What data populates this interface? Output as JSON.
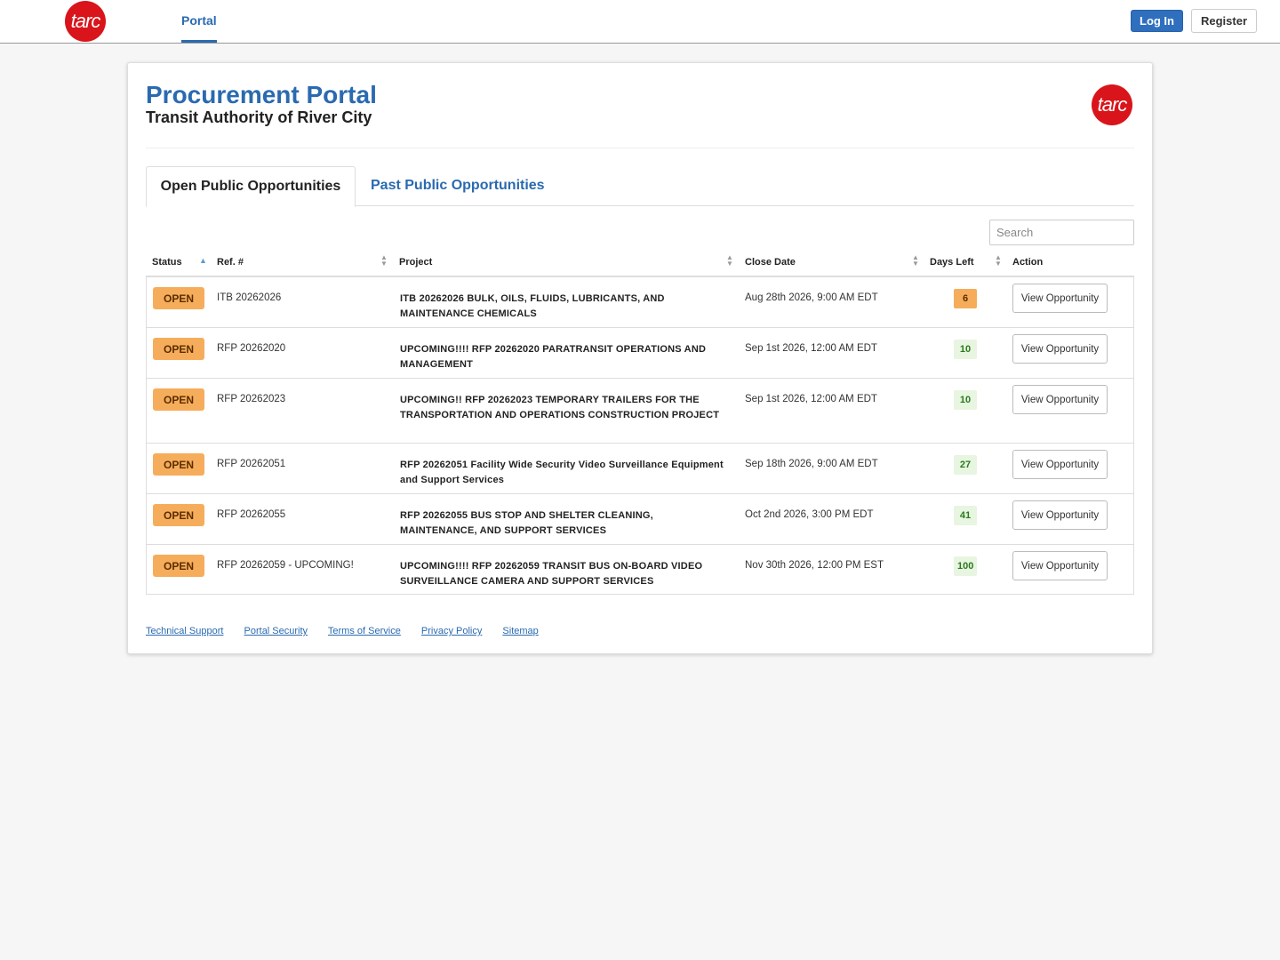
{
  "nav": {
    "logo_text": "tarc",
    "portal_label": "Portal",
    "login_label": "Log In",
    "register_label": "Register"
  },
  "header": {
    "title": "Procurement Portal",
    "subtitle": "Transit Authority of River City",
    "logo_text": "tarc"
  },
  "tabs": [
    {
      "label": "Open Public Opportunities",
      "active": true
    },
    {
      "label": "Past Public Opportunities",
      "active": false
    }
  ],
  "search": {
    "placeholder": "Search"
  },
  "table": {
    "columns": [
      "Status",
      "Ref. #",
      "Project",
      "Close Date",
      "Days Left",
      "Action"
    ],
    "rows": [
      {
        "status": "OPEN",
        "ref": "ITB 20262026",
        "project": "ITB 20262026 BULK, OILS, FLUIDS, LUBRICANTS, AND MAINTENANCE CHEMICALS",
        "close": "Aug 28th 2026, 9:00 AM EDT",
        "days": "6",
        "days_level": "warn",
        "action": "View Opportunity"
      },
      {
        "status": "OPEN",
        "ref": "RFP 20262020",
        "project": "UPCOMING!!!! RFP 20262020 PARATRANSIT OPERATIONS AND MANAGEMENT",
        "close": "Sep 1st 2026, 12:00 AM EDT",
        "days": "10",
        "days_level": "ok",
        "action": "View Opportunity"
      },
      {
        "status": "OPEN",
        "ref": "RFP 20262023",
        "project": "UPCOMING!! RFP 20262023 TEMPORARY TRAILERS FOR THE TRANSPORTATION AND OPERATIONS CONSTRUCTION PROJECT",
        "close": "Sep 1st 2026, 12:00 AM EDT",
        "days": "10",
        "days_level": "ok",
        "action": "View Opportunity"
      },
      {
        "status": "OPEN",
        "ref": "RFP 20262051",
        "project": "RFP 20262051 Facility Wide Security Video Surveillance Equipment and Support Services",
        "close": "Sep 18th 2026, 9:00 AM EDT",
        "days": "27",
        "days_level": "ok",
        "action": "View Opportunity"
      },
      {
        "status": "OPEN",
        "ref": "RFP 20262055",
        "project": "RFP 20262055 BUS STOP AND SHELTER CLEANING, MAINTENANCE, AND SUPPORT SERVICES",
        "close": "Oct 2nd 2026, 3:00 PM EDT",
        "days": "41",
        "days_level": "ok",
        "action": "View Opportunity"
      },
      {
        "status": "OPEN",
        "ref": "RFP 20262059 - UPCOMING!",
        "project": "UPCOMING!!!! RFP 20262059 TRANSIT BUS ON-BOARD VIDEO SURVEILLANCE CAMERA AND SUPPORT SERVICES",
        "close": "Nov 30th 2026, 12:00 PM EST",
        "days": "100",
        "days_level": "ok",
        "action": "View Opportunity"
      }
    ]
  },
  "footer": {
    "links": [
      "Technical Support",
      "Portal Security",
      "Terms of Service",
      "Privacy Policy",
      "Sitemap"
    ]
  },
  "colors": {
    "brand_blue": "#2a6ab0",
    "brand_red": "#d9141b",
    "status_orange": "#f6ad5b",
    "days_ok_bg": "#e8f5e1"
  }
}
